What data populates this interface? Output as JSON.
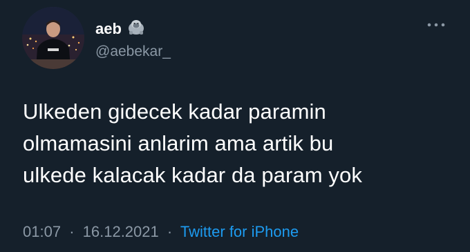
{
  "user": {
    "display_name": "aeb",
    "name_emoji": "gorilla-emoji",
    "handle": "@aebekar_"
  },
  "tweet": {
    "text": "Ulkeden gidecek kadar paramin\nolmamasini anlarim ama artik bu\nulkede kalacak kadar da param yok",
    "time": "01:07",
    "separator": "·",
    "date": "16.12.2021",
    "source": "Twitter for iPhone"
  },
  "icons": {
    "more": "more-horizontal-icon"
  },
  "colors": {
    "background": "#15202b",
    "text_primary": "#ffffff",
    "text_secondary": "#8b98a5",
    "link": "#1d9bf0"
  }
}
